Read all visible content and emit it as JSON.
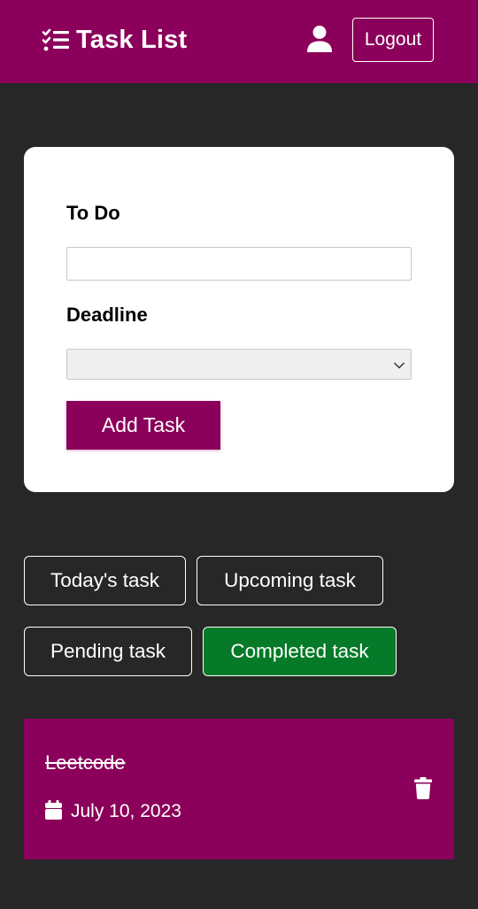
{
  "header": {
    "title": "Task List",
    "brand_icon": "task-list-icon",
    "user_icon": "user-icon",
    "logout_label": "Logout"
  },
  "form": {
    "todo_label": "To Do",
    "todo_value": "",
    "deadline_label": "Deadline",
    "deadline_value": "",
    "add_button_label": "Add Task"
  },
  "filters": [
    {
      "label": "Today's task",
      "active": false
    },
    {
      "label": "Upcoming task",
      "active": false
    },
    {
      "label": "Pending task",
      "active": false
    },
    {
      "label": "Completed task",
      "active": true
    }
  ],
  "tasks": [
    {
      "title": "Leetcode",
      "date": "July 10, 2023",
      "completed": true,
      "date_icon": "calendar-icon",
      "delete_icon": "trash-icon"
    }
  ],
  "colors": {
    "background": "#272727",
    "brand": "#8b005a",
    "active_filter": "#057a28",
    "card": "#ffffff"
  }
}
